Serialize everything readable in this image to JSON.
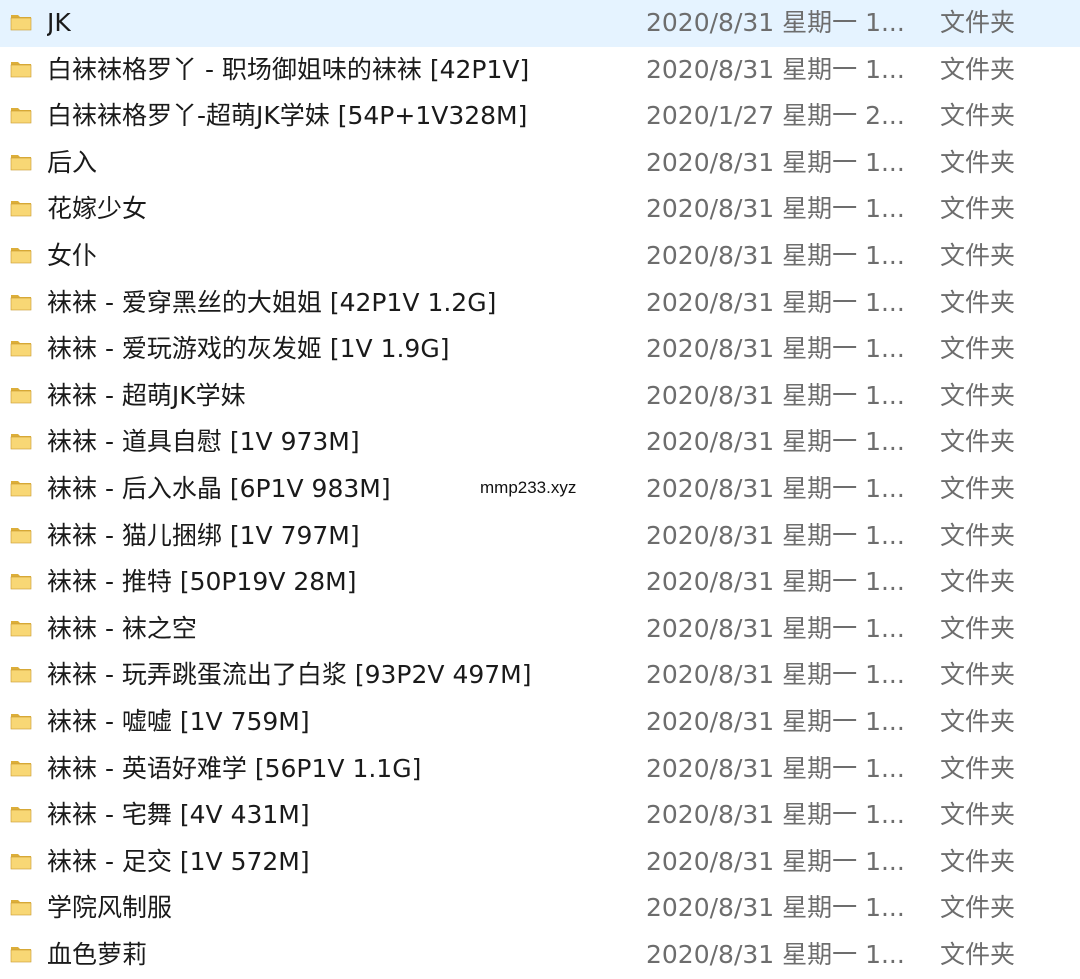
{
  "watermark": "mmp233.xyz",
  "icon": "folder-icon",
  "colors": {
    "folder_body": "#f8d775",
    "folder_tab": "#dcae3a",
    "folder_edge": "#c99a2e",
    "name_text": "#1a1a1a",
    "meta_text": "#6d6d6d"
  },
  "rows": [
    {
      "name": "JK",
      "date": "2020/8/31 星期一 1...",
      "type": "文件夹"
    },
    {
      "name": "白袜袜格罗丫 - 职场御姐味的袜袜 [42P1V]",
      "date": "2020/8/31 星期一 1...",
      "type": "文件夹"
    },
    {
      "name": "白袜袜格罗丫-超萌JK学妹 [54P+1V328M]",
      "date": "2020/1/27 星期一 2...",
      "type": "文件夹"
    },
    {
      "name": "后入",
      "date": "2020/8/31 星期一 1...",
      "type": "文件夹"
    },
    {
      "name": "花嫁少女",
      "date": "2020/8/31 星期一 1...",
      "type": "文件夹"
    },
    {
      "name": "女仆",
      "date": "2020/8/31 星期一 1...",
      "type": "文件夹"
    },
    {
      "name": "袜袜 - 爱穿黑丝的大姐姐 [42P1V 1.2G]",
      "date": "2020/8/31 星期一 1...",
      "type": "文件夹"
    },
    {
      "name": "袜袜 - 爱玩游戏的灰发姬 [1V 1.9G]",
      "date": "2020/8/31 星期一 1...",
      "type": "文件夹"
    },
    {
      "name": "袜袜 - 超萌JK学妹",
      "date": "2020/8/31 星期一 1...",
      "type": "文件夹"
    },
    {
      "name": "袜袜 - 道具自慰 [1V 973M]",
      "date": "2020/8/31 星期一 1...",
      "type": "文件夹"
    },
    {
      "name": "袜袜 - 后入水晶 [6P1V 983M]",
      "date": "2020/8/31 星期一 1...",
      "type": "文件夹"
    },
    {
      "name": "袜袜 - 猫儿捆绑 [1V 797M]",
      "date": "2020/8/31 星期一 1...",
      "type": "文件夹"
    },
    {
      "name": "袜袜 - 推特 [50P19V 28M]",
      "date": "2020/8/31 星期一 1...",
      "type": "文件夹"
    },
    {
      "name": "袜袜 - 袜之空",
      "date": "2020/8/31 星期一 1...",
      "type": "文件夹"
    },
    {
      "name": "袜袜 - 玩弄跳蛋流出了白浆 [93P2V 497M]",
      "date": "2020/8/31 星期一 1...",
      "type": "文件夹"
    },
    {
      "name": "袜袜 - 嘘嘘 [1V 759M]",
      "date": "2020/8/31 星期一 1...",
      "type": "文件夹"
    },
    {
      "name": "袜袜 - 英语好难学 [56P1V 1.1G]",
      "date": "2020/8/31 星期一 1...",
      "type": "文件夹"
    },
    {
      "name": "袜袜 - 宅舞 [4V 431M]",
      "date": "2020/8/31 星期一 1...",
      "type": "文件夹"
    },
    {
      "name": "袜袜 - 足交 [1V 572M]",
      "date": "2020/8/31 星期一 1...",
      "type": "文件夹"
    },
    {
      "name": "学院风制服",
      "date": "2020/8/31 星期一 1...",
      "type": "文件夹"
    },
    {
      "name": "血色萝莉",
      "date": "2020/8/31 星期一 1...",
      "type": "文件夹"
    }
  ]
}
